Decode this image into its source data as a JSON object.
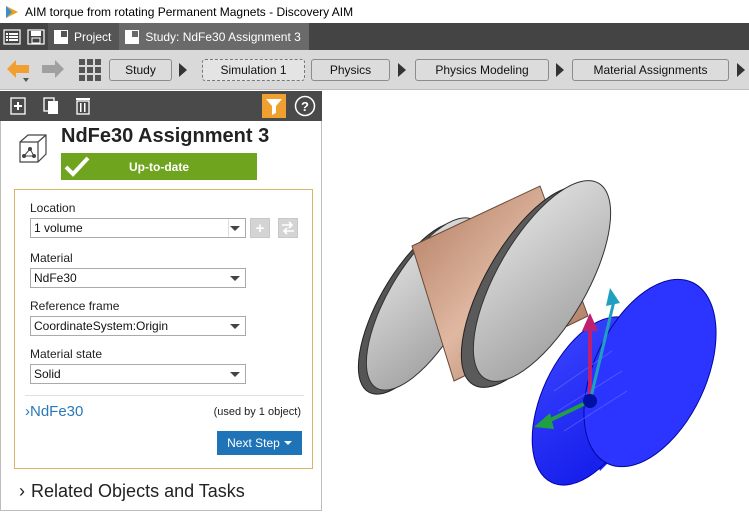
{
  "window": {
    "title": "AIM torque from rotating Permanent Magnets - Discovery AIM"
  },
  "tabs": [
    {
      "label": "Project"
    },
    {
      "label": "Study: NdFe30 Assignment 3"
    }
  ],
  "workflow": {
    "steps": [
      "Study",
      "Simulation 1",
      "Physics",
      "Physics Modeling",
      "Material Assignments"
    ]
  },
  "panel": {
    "title": "NdFe30 Assignment 3",
    "status": "Up-to-date",
    "location": {
      "label": "Location",
      "value": "1 volume"
    },
    "material": {
      "label": "Material",
      "value": "NdFe30"
    },
    "reference_frame": {
      "label": "Reference frame",
      "value": "CoordinateSystem:Origin"
    },
    "material_state": {
      "label": "Material state",
      "value": "Solid"
    },
    "material_link": "NdFe30",
    "used_by": "(used by 1 object)",
    "next_step": "Next Step",
    "related": "Related Objects and Tasks"
  },
  "colors": {
    "accent_orange": "#f0a030",
    "status_green": "#6fa41f",
    "link_blue": "#2a78b8",
    "button_blue": "#1f73b7",
    "magnet_blue": "#1c25ff",
    "coil_copper": "#c8957a"
  }
}
